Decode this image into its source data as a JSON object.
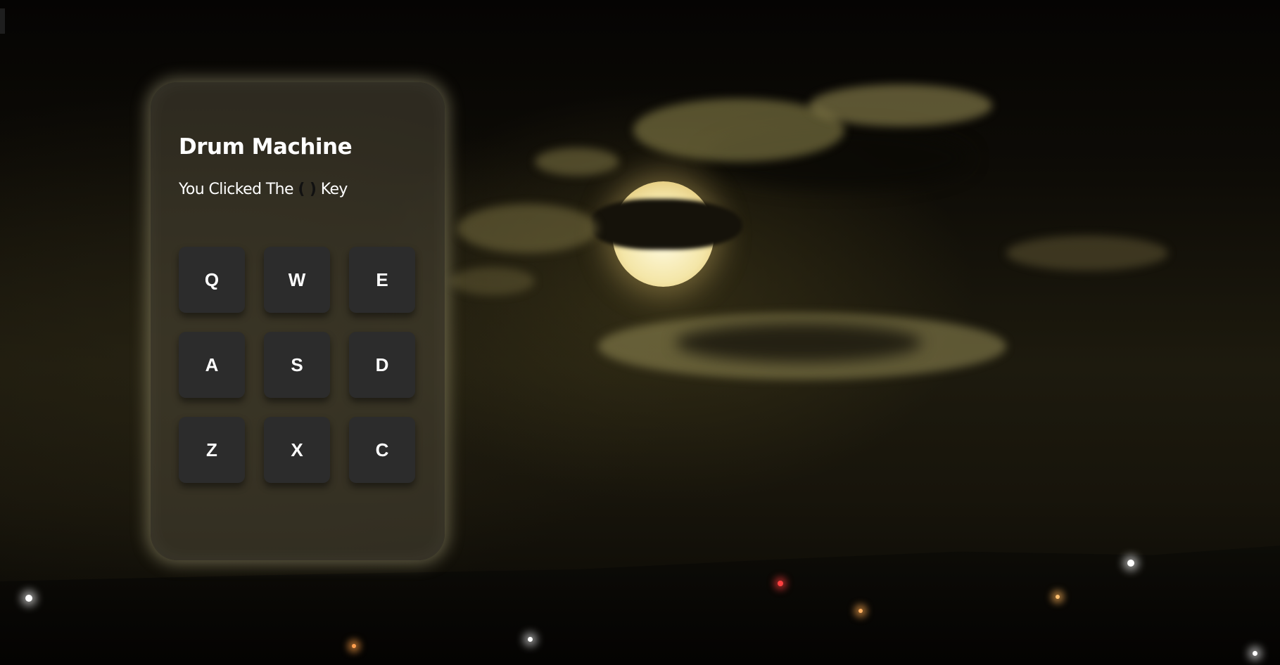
{
  "app": {
    "title": "Drum Machine",
    "status_prefix": "You Clicked The",
    "status_key": "( )",
    "status_suffix": "Key"
  },
  "pads": [
    "Q",
    "W",
    "E",
    "A",
    "S",
    "D",
    "Z",
    "X",
    "C"
  ],
  "colors": {
    "panel_bg": "#48443a",
    "panel_glow": "#e6dcaa",
    "pad_bg": "#2c2c2c",
    "pad_text": "#ffffff",
    "key_indicator": "#111111"
  },
  "background": {
    "description_icon": "night-sky-moon-city-icon"
  }
}
